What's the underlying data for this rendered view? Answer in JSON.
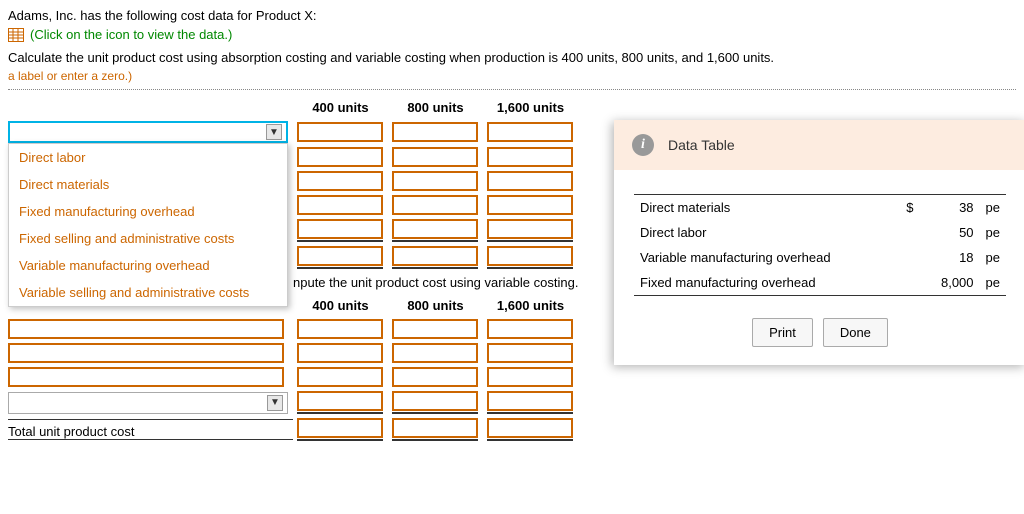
{
  "intro": "Adams, Inc. has the following cost data for Product X:",
  "data_link": "(Click on the icon to view the data.)",
  "question": "Calculate the unit product cost using absorption costing and variable costing when production is 400 units, 800 units, and 1,600 units.",
  "hint_fragment": "a label or enter a zero.)",
  "column_headers": [
    "400 units",
    "800 units",
    "1,600 units"
  ],
  "dropdown_options": [
    "Direct labor",
    "Direct materials",
    "Fixed manufacturing overhead",
    "Fixed selling and administrative costs",
    "Variable manufacturing overhead",
    "Variable selling and administrative costs"
  ],
  "mid_text_fragment": "npute the unit product cost using variable costing.",
  "total_label": "Total unit product cost",
  "modal": {
    "title": "Data Table",
    "rows": [
      {
        "label": "Direct materials",
        "currency": "$",
        "value": "38",
        "unit": "pe"
      },
      {
        "label": "Direct labor",
        "currency": "",
        "value": "50",
        "unit": "pe"
      },
      {
        "label": "Variable manufacturing overhead",
        "currency": "",
        "value": "18",
        "unit": "pe"
      },
      {
        "label": "Fixed manufacturing overhead",
        "currency": "",
        "value": "8,000",
        "unit": "pe"
      }
    ],
    "buttons": {
      "print": "Print",
      "done": "Done"
    }
  }
}
